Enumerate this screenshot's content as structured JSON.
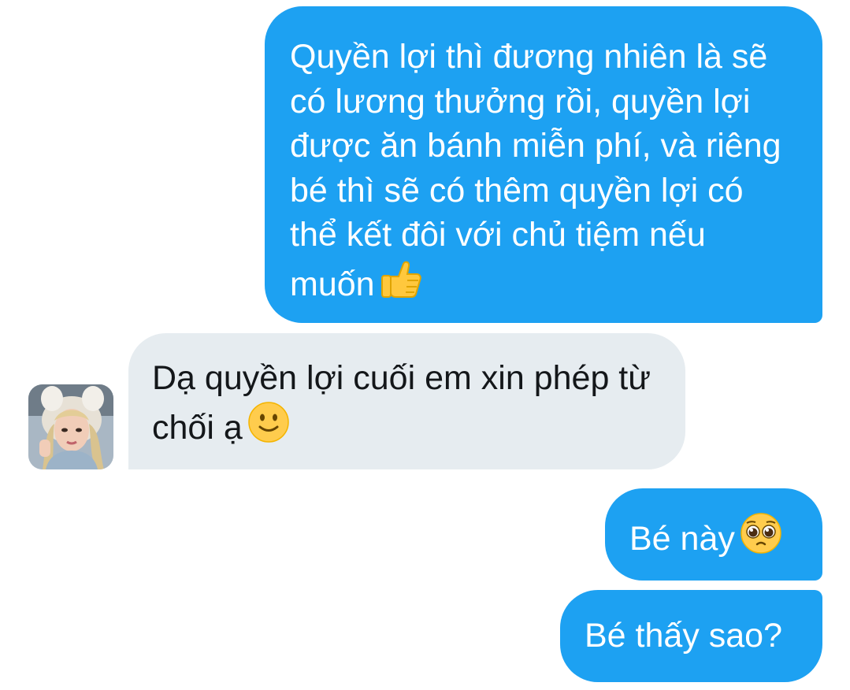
{
  "conversation": {
    "messages": [
      {
        "direction": "sent",
        "text": "Quyền lợi thì đương nhiên là sẽ có lương thưởng rồi, quyền lợi được ăn bánh miễn phí, và riêng bé thì sẽ có thêm quyền lợi có thể kết đôi với chủ tiệm nếu muốn",
        "emoji": "thumbs-up"
      },
      {
        "direction": "received",
        "text": "Dạ quyền lợi cuối em xin phép từ chối ạ",
        "emoji": "slightly-smiling-face"
      },
      {
        "direction": "sent",
        "text": "Bé này",
        "emoji": "pleading-face"
      },
      {
        "direction": "sent",
        "text": "Bé thấy sao?"
      }
    ]
  },
  "theme": {
    "sent_bubble_color": "#1da1f2",
    "received_bubble_color": "#e6ecf0",
    "sent_text_color": "#ffffff",
    "received_text_color": "#14171a"
  }
}
